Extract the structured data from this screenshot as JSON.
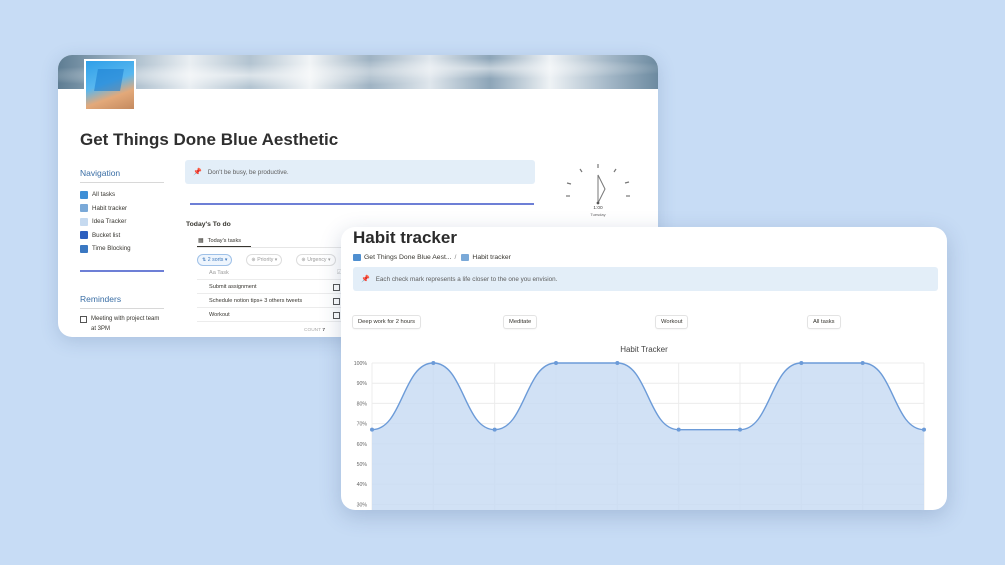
{
  "gtd": {
    "title": "Get Things Done Blue Aesthetic",
    "navigation": {
      "heading": "Navigation",
      "items": [
        {
          "label": "All tasks",
          "icon": "grid-icon",
          "color": "#3f8fd6"
        },
        {
          "label": "Habit tracker",
          "icon": "image-icon",
          "color": "#7aa9d8"
        },
        {
          "label": "Idea Tracker",
          "icon": "image-icon",
          "color": "#c6daf0"
        },
        {
          "label": "Bucket list",
          "icon": "image-icon",
          "color": "#2c5fbf"
        },
        {
          "label": "Time Blocking",
          "icon": "image-icon",
          "color": "#3a78c2"
        }
      ]
    },
    "reminders": {
      "heading": "Reminders",
      "item": "Meeting with project team at 3PM"
    },
    "callout": "Don't be busy, be productive.",
    "clock": {
      "time": "1:00",
      "day": "Tuesday"
    },
    "todo": {
      "heading": "Today's To do",
      "tab": "Today's tasks",
      "filters": [
        "2 sorts",
        "Priority",
        "Urgency"
      ],
      "column": "Aa Task",
      "tasks": [
        "Submit assignment",
        "Schedule notion tips+ 3 others tweets",
        "Workout"
      ],
      "count_label": "COUNT",
      "count": "7"
    }
  },
  "habit": {
    "title": "Habit tracker",
    "breadcrumb": [
      "Get Things Done Blue Aest...",
      "Habit tracker"
    ],
    "callout": "Each check mark represents a life closer to the one you envision.",
    "buttons": [
      "Deep work for 2 hours",
      "Meditate",
      "Workout",
      "All tasks"
    ]
  },
  "colors": {
    "accent": "#6d7fd6",
    "line": "#6c9bd8",
    "area": "#c9dcf3",
    "callout": "#e3eef8"
  },
  "chart_data": {
    "type": "area",
    "title": "Habit Tracker",
    "y_ticks": [
      "100%",
      "90%",
      "80%",
      "70%",
      "60%",
      "50%",
      "40%",
      "30%"
    ],
    "ylim": [
      30,
      100
    ],
    "values": [
      67,
      100,
      67,
      100,
      100,
      67,
      67,
      100,
      100,
      67
    ],
    "grid": true
  }
}
